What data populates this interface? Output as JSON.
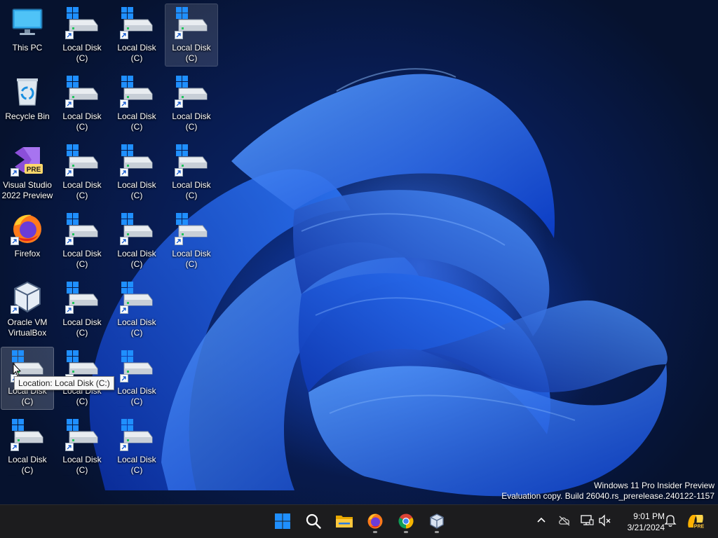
{
  "desktop": {
    "icons": [
      {
        "label": "This PC",
        "type": "pc"
      },
      {
        "label": "Recycle Bin",
        "type": "recycle"
      },
      {
        "label": "Visual Studio\n2022 Preview",
        "type": "vs"
      },
      {
        "label": "Firefox",
        "type": "firefox"
      },
      {
        "label": "Oracle VM\nVirtualBox",
        "type": "vbox"
      },
      {
        "label": "Local Disk (C)\n- Shortcut",
        "type": "disk"
      },
      {
        "label": "Local Disk (C)\n- Shortcut -...",
        "type": "disk"
      },
      {
        "label": "Local Disk (C)\n- Shortcut -...",
        "type": "disk"
      },
      {
        "label": "Local Disk (C)\n- Shortcut -...",
        "type": "disk"
      },
      {
        "label": "Local Disk (C)\n- Shortcut -...",
        "type": "disk"
      },
      {
        "label": "Local Disk (C)\n- Shortcut -...",
        "type": "disk"
      },
      {
        "label": "Local Disk (C)\n- Shortcut -...",
        "type": "disk"
      },
      {
        "label": "Local Disk (C)\n- Shortcut -...",
        "type": "disk"
      },
      {
        "label": "Local Disk (C)\n- Shortcut -...",
        "type": "disk"
      },
      {
        "label": "Local Disk (C)\n- Shortcut -...",
        "type": "disk"
      },
      {
        "label": "Local Disk (C)\n- Shortcut -...",
        "type": "disk"
      },
      {
        "label": "Local Disk (C)\n- Shortcut -...",
        "type": "disk"
      },
      {
        "label": "Local Disk (C)\n- Shortcut -...",
        "type": "disk"
      },
      {
        "label": "Local Disk (C)\n- Shortcut -...",
        "type": "disk"
      },
      {
        "label": "Local Disk (C)\n- Shortcut -...",
        "type": "disk"
      },
      {
        "label": "Local Disk (C)\n- Shortcut -...",
        "type": "disk"
      },
      {
        "label": "Local Disk (C)\n- Shortcut -...",
        "type": "disk"
      },
      {
        "label": "Local Disk (C)\n- Shortcut -...",
        "type": "disk"
      },
      {
        "label": "Local Disk (C)\n- Shortcut -...",
        "type": "disk"
      },
      {
        "label": "Local Disk (C)\n- Shortcut -...",
        "type": "disk"
      },
      {
        "label": "Local Disk (C)\n- Shortcut -...",
        "type": "disk"
      },
      {
        "label": "Local Disk (C)\n- Shortcut -...",
        "type": "disk"
      }
    ],
    "tooltip": "Location: Local Disk (C:)",
    "watermark_line1": "Windows 11 Pro Insider Preview",
    "watermark_line2": "Evaluation copy. Build 26040.rs_prerelease.240122-1157"
  },
  "taskbar": {
    "apps": [
      {
        "name": "start-button",
        "icon": "windows-logo-icon"
      },
      {
        "name": "search-button",
        "icon": "search-icon"
      },
      {
        "name": "file-explorer-button",
        "icon": "folder-icon"
      },
      {
        "name": "firefox-button",
        "icon": "firefox-icon"
      },
      {
        "name": "chrome-button",
        "icon": "chrome-icon"
      },
      {
        "name": "virtualbox-button",
        "icon": "virtualbox-icon"
      }
    ],
    "tray": {
      "time": "9:01 PM",
      "date": "3/21/2024",
      "copilot_badge": "PRE"
    }
  },
  "colors": {
    "taskbar_bg": "#1c1c1e",
    "windows_blue": "#1f8fff",
    "accent_blue": "#0d5cff"
  }
}
